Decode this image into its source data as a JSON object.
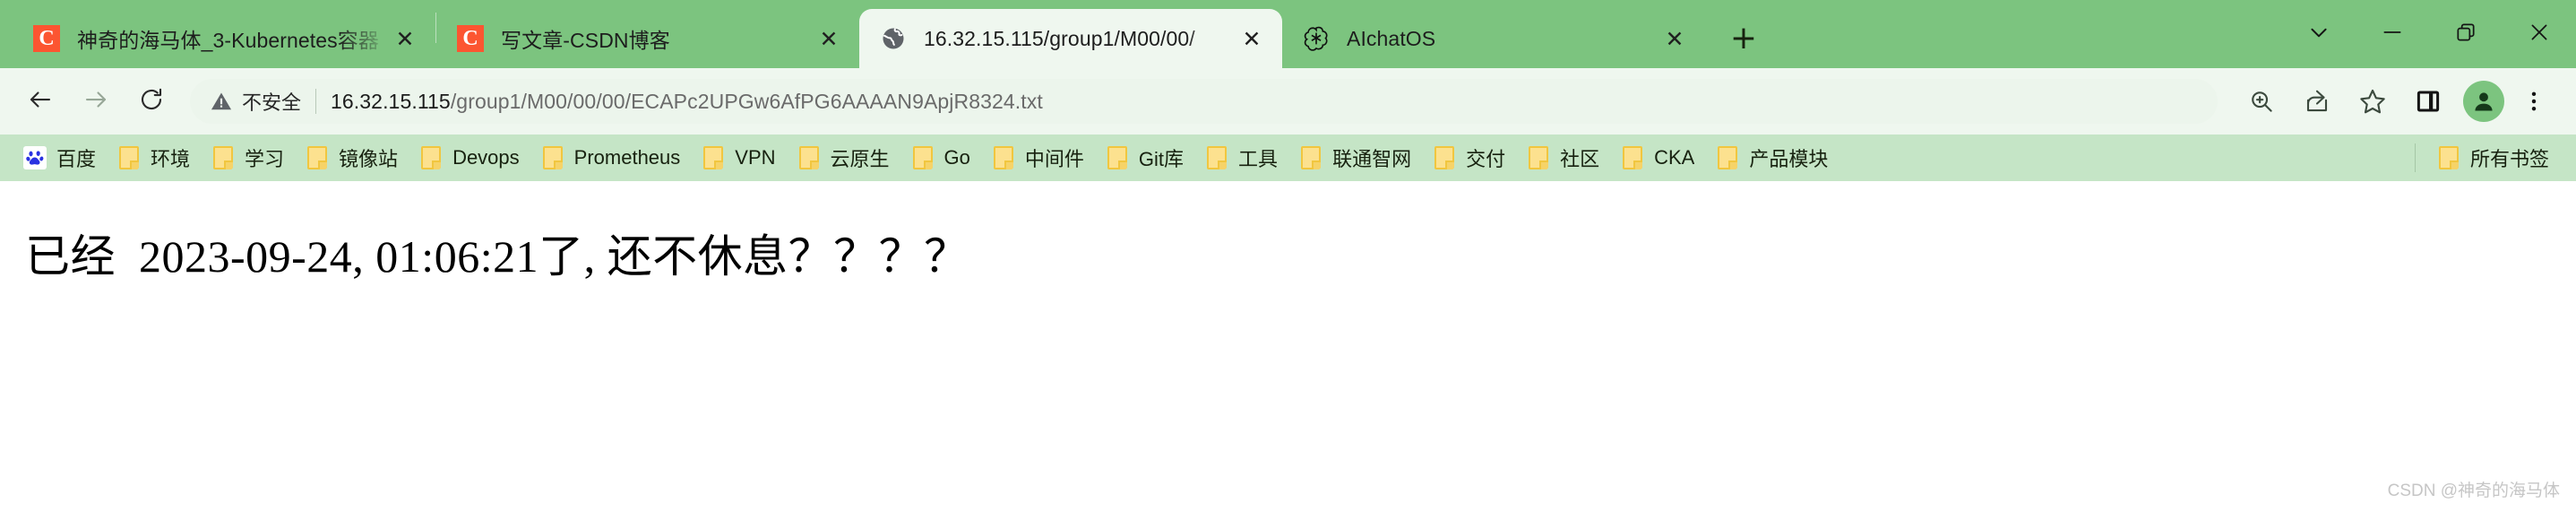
{
  "window": {
    "controls": [
      {
        "name": "tab-search",
        "icon": "chevron-down-icon",
        "label": "∨"
      },
      {
        "name": "minimize",
        "icon": "minimize-icon",
        "label": "—"
      },
      {
        "name": "maximize",
        "icon": "restore-icon",
        "label": "❐"
      },
      {
        "name": "close",
        "icon": "close-icon",
        "label": "✕"
      }
    ]
  },
  "tabs": [
    {
      "title": "神奇的海马体_3-Kubernetes容器",
      "favicon": "csdn-icon",
      "active": false,
      "close_label": "✕"
    },
    {
      "title": "写文章-CSDN博客",
      "favicon": "csdn-icon",
      "active": false,
      "close_label": "✕"
    },
    {
      "title": "16.32.15.115/group1/M00/00/",
      "favicon": "globe-icon",
      "active": true,
      "close_label": "✕"
    },
    {
      "title": "AIchatOS",
      "favicon": "openai-icon",
      "active": false,
      "close_label": "✕"
    }
  ],
  "new_tab_label": "+",
  "toolbar": {
    "back_label": "←",
    "forward_label": "→",
    "reload_label": "⟳",
    "security_text": "不安全",
    "url_host": "16.32.15.115",
    "url_path": "/group1/M00/00/00/ECAPc2UPGw6AfPG6AAAAN9ApjR8324.txt",
    "url_full": "16.32.15.115/group1/M00/00/00/ECAPc2UPGw6AfPG6AAAAN9ApjR8324.txt",
    "icons": [
      {
        "name": "zoom-icon"
      },
      {
        "name": "share-icon"
      },
      {
        "name": "bookmark-star-icon"
      },
      {
        "name": "side-panel-icon"
      },
      {
        "name": "profile-avatar-icon"
      },
      {
        "name": "more-menu-icon"
      }
    ]
  },
  "bookmarks": {
    "items": [
      {
        "label": "百度",
        "icon": "baidu-icon"
      },
      {
        "label": "环境",
        "icon": "folder-icon"
      },
      {
        "label": "学习",
        "icon": "folder-icon"
      },
      {
        "label": "镜像站",
        "icon": "folder-icon"
      },
      {
        "label": "Devops",
        "icon": "folder-icon"
      },
      {
        "label": "Prometheus",
        "icon": "folder-icon"
      },
      {
        "label": "VPN",
        "icon": "folder-icon"
      },
      {
        "label": "云原生",
        "icon": "folder-icon"
      },
      {
        "label": "Go",
        "icon": "folder-icon"
      },
      {
        "label": "中间件",
        "icon": "folder-icon"
      },
      {
        "label": "Git库",
        "icon": "folder-icon"
      },
      {
        "label": "工具",
        "icon": "folder-icon"
      },
      {
        "label": "联通智网",
        "icon": "folder-icon"
      },
      {
        "label": "交付",
        "icon": "folder-icon"
      },
      {
        "label": "社区",
        "icon": "folder-icon"
      },
      {
        "label": "CKA",
        "icon": "folder-icon"
      },
      {
        "label": "产品模块",
        "icon": "folder-icon"
      }
    ],
    "all_bookmarks": {
      "label": "所有书签",
      "icon": "folder-icon"
    }
  },
  "page": {
    "content": "已经  2023-09-24, 01:06:21了, 还不休息？？？？",
    "watermark": "CSDN @神奇的海马体"
  }
}
